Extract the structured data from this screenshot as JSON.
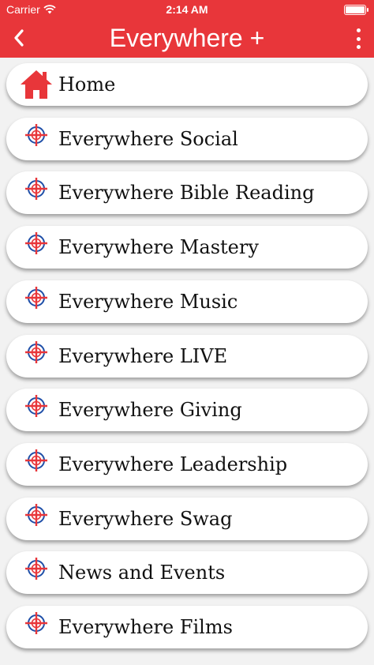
{
  "status": {
    "carrier": "Carrier",
    "time": "2:14 AM",
    "battery_level": 1.0
  },
  "nav": {
    "title": "Everywhere +"
  },
  "colors": {
    "header": "#e8363a",
    "icon_red": "#e8363a",
    "icon_blue": "#1f4fa8"
  },
  "menu": [
    {
      "label": "Home",
      "icon": "home-icon"
    },
    {
      "label": "Everywhere Social",
      "icon": "everywhere-crosshair-logo"
    },
    {
      "label": "Everywhere Bible Reading",
      "icon": "everywhere-crosshair-logo"
    },
    {
      "label": "Everywhere Mastery",
      "icon": "everywhere-crosshair-logo"
    },
    {
      "label": "Everywhere Music",
      "icon": "everywhere-crosshair-logo"
    },
    {
      "label": "Everywhere LIVE",
      "icon": "everywhere-crosshair-logo"
    },
    {
      "label": "Everywhere Giving",
      "icon": "everywhere-crosshair-logo"
    },
    {
      "label": "Everywhere Leadership",
      "icon": "everywhere-crosshair-logo"
    },
    {
      "label": "Everywhere Swag",
      "icon": "everywhere-crosshair-logo"
    },
    {
      "label": "News and Events",
      "icon": "everywhere-crosshair-logo"
    },
    {
      "label": "Everywhere Films",
      "icon": "everywhere-crosshair-logo"
    }
  ]
}
